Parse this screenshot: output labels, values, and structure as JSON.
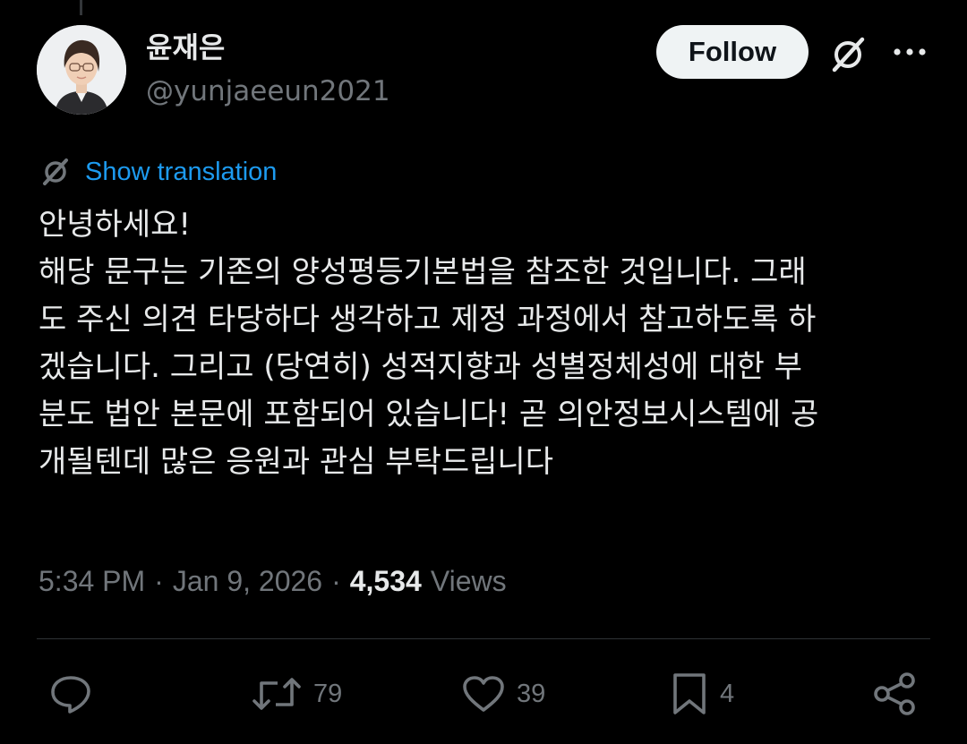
{
  "author": {
    "display_name": "윤재은",
    "handle": "@yunjaeeun2021"
  },
  "header": {
    "follow_label": "Follow",
    "grok_icon": "grok-icon",
    "more_icon": "more-icon"
  },
  "tweet": {
    "translate_label": "Show translation",
    "lines": [
      "안녕하세요!",
      "해당 문구는 기존의 양성평등기본법을 참조한 것입니다. 그래",
      "도 주신 의견 타당하다 생각하고 제정 과정에서 참고하도록 하",
      "겠습니다. 그리고 (당연히) 성적지향과 성별정체성에 대한 부",
      "분도 법안 본문에 포함되어 있습니다! 곧 의안정보시스템에 공",
      "개될텐데 많은 응원과 관심 부탁드립니다"
    ]
  },
  "meta": {
    "time": "5:34 PM",
    "separator": "·",
    "date": "Jan 9, 2026",
    "views_count": "4,534",
    "views_label": "Views"
  },
  "actions": {
    "reply_count": "",
    "repost_count": "79",
    "like_count": "39",
    "bookmark_count": "4"
  },
  "colors": {
    "background": "#000000",
    "text": "#e7e9ea",
    "secondary": "#71767b",
    "link": "#1d9bf0",
    "follow_bg": "#eff3f4"
  }
}
